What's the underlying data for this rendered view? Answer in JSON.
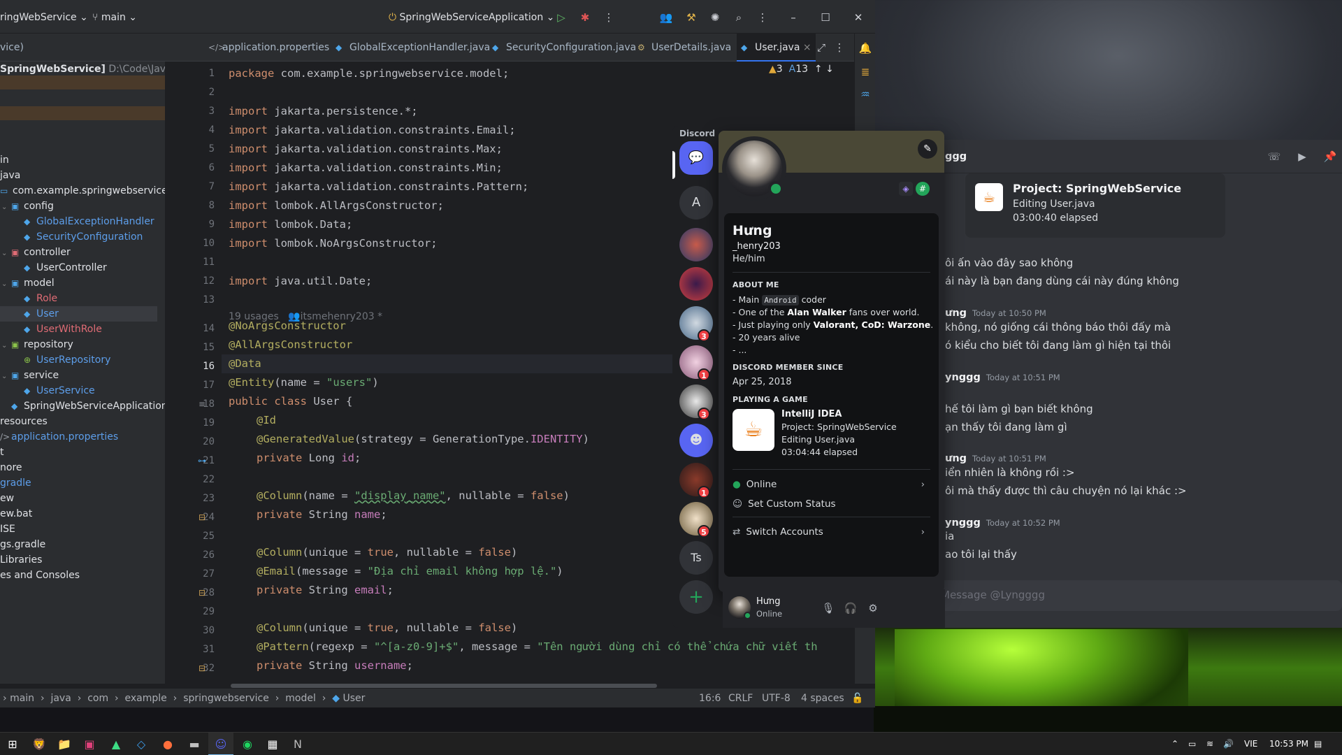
{
  "ide": {
    "project_name": "ringWebService",
    "branch": "main",
    "run_config": "SpringWebServiceApplication",
    "tabs": [
      {
        "label": "vice)",
        "icon": ""
      },
      {
        "label": "application.properties",
        "icon": "</>"
      },
      {
        "label": "GlobalExceptionHandler.java",
        "icon": "◆"
      },
      {
        "label": "SecurityConfiguration.java",
        "icon": "◆"
      },
      {
        "label": "UserDetails.java",
        "icon": "⚙"
      },
      {
        "label": "User.java",
        "icon": "◆",
        "close": "×"
      }
    ],
    "inspections": {
      "warnings": "3",
      "typos": "13"
    },
    "tree_root": "SpringWebService]",
    "tree_root_path": "D:\\Code\\Java\\S",
    "tree": [
      {
        "label": "in"
      },
      {
        "label": "java"
      },
      {
        "label": "com.example.springwebservice"
      },
      {
        "label": "config"
      },
      {
        "label": "GlobalExceptionHandler"
      },
      {
        "label": "SecurityConfiguration"
      },
      {
        "label": "controller"
      },
      {
        "label": "UserController"
      },
      {
        "label": "model"
      },
      {
        "label": "Role"
      },
      {
        "label": "User"
      },
      {
        "label": "UserWithRole"
      },
      {
        "label": "repository"
      },
      {
        "label": "UserRepository"
      },
      {
        "label": "service"
      },
      {
        "label": "UserService"
      },
      {
        "label": "SpringWebServiceApplication"
      },
      {
        "label": "resources"
      },
      {
        "label": "application.properties"
      },
      {
        "label": "t"
      },
      {
        "label": "nore"
      },
      {
        "label": "gradle"
      },
      {
        "label": "ew"
      },
      {
        "label": "ew.bat"
      },
      {
        "label": "ISE"
      },
      {
        "label": "gs.gradle"
      },
      {
        "label": "Libraries"
      },
      {
        "label": "es and Consoles"
      }
    ],
    "line_numbers": [
      "1",
      "2",
      "3",
      "4",
      "5",
      "6",
      "7",
      "8",
      "9",
      "10",
      "11",
      "12",
      "13",
      "14",
      "15",
      "16",
      "17",
      "18",
      "19",
      "20",
      "21",
      "22",
      "23",
      "24",
      "25",
      "26",
      "27",
      "28",
      "29",
      "30",
      "31",
      "32"
    ],
    "usage_hint": "19 usages",
    "usage_author": "itsmehenry203 *",
    "code": {
      "l1": [
        "package",
        " com.example.springwebservice.model;"
      ],
      "l3": [
        "import",
        " jakarta.persistence.*;"
      ],
      "l4": [
        "import",
        " jakarta.validation.constraints.Email;"
      ],
      "l5": [
        "import",
        " jakarta.validation.constraints.Max;"
      ],
      "l6": [
        "import",
        " jakarta.validation.constraints.Min;"
      ],
      "l7": [
        "import",
        " jakarta.validation.constraints.Pattern;"
      ],
      "l8": [
        "import",
        " lombok.AllArgsConstructor;"
      ],
      "l9": [
        "import",
        " lombok.Data;"
      ],
      "l10": [
        "import",
        " lombok.NoArgsConstructor;"
      ],
      "l12": [
        "import",
        " java.util.Date;"
      ],
      "l14": "@NoArgsConstructor",
      "l15": "@AllArgsConstructor",
      "l16": "@Data",
      "l17": [
        "@Entity",
        "(name = ",
        "\"users\"",
        ")"
      ],
      "l18": [
        "public class",
        " User {"
      ],
      "l19": "@Id",
      "l20": [
        "@GeneratedValue",
        "(strategy = GenerationType.",
        "IDENTITY",
        ")"
      ],
      "l21": [
        "private",
        " Long ",
        "id",
        ";"
      ],
      "l23": [
        "@Column",
        "(name = ",
        "\"display_name\"",
        ", nullable = ",
        "false",
        ")"
      ],
      "l24": [
        "private",
        " String ",
        "name",
        ";"
      ],
      "l26": [
        "@Column",
        "(unique = ",
        "true",
        ", nullable = ",
        "false",
        ")"
      ],
      "l27": [
        "@Email",
        "(message = ",
        "\"Địa chỉ email không hợp lệ.\"",
        ")"
      ],
      "l28": [
        "private",
        " String ",
        "email",
        ";"
      ],
      "l30": [
        "@Column",
        "(unique = ",
        "true",
        ", nullable = ",
        "false",
        ")"
      ],
      "l31": [
        "@Pattern",
        "(regexp = ",
        "\"^[a-z0-9]+$\"",
        ", message = ",
        "\"Tên người dùng chỉ có thể chứa chữ viết th"
      ],
      "l32": [
        "private",
        " String ",
        "username",
        ";"
      ]
    },
    "breadcrumbs": [
      "main",
      "java",
      "com",
      "example",
      "springwebservice",
      "model",
      "User"
    ],
    "status": {
      "position": "16:6",
      "line_sep": "CRLF",
      "encoding": "UTF-8",
      "indent": "4 spaces"
    }
  },
  "discord": {
    "brand": "Discord",
    "servers": [
      {
        "label": "",
        "badge": ""
      },
      {
        "label": "A",
        "badge": ""
      },
      {
        "label": "",
        "badge": ""
      },
      {
        "label": "",
        "badge": ""
      },
      {
        "label": "",
        "badge": "3"
      },
      {
        "label": "",
        "badge": "1"
      },
      {
        "label": "",
        "badge": "3"
      },
      {
        "label": "",
        "badge": ""
      },
      {
        "label": "",
        "badge": "1"
      },
      {
        "label": "",
        "badge": "5"
      },
      {
        "label": "Ts",
        "badge": ""
      },
      {
        "label": "+",
        "badge": ""
      }
    ],
    "profile": {
      "display_name": "Hưng",
      "username": "_henry203",
      "pronouns": "He/him",
      "about_heading": "ABOUT ME",
      "about_lines": [
        {
          "pre": "- Main ",
          "code": "Android",
          "post": " coder"
        },
        {
          "pre": "- One of the ",
          "bold": "Alan Walker",
          "post": " fans over world."
        },
        {
          "pre": "- Just playing only ",
          "bold": "Valorant, CoD: Warzone",
          "post": "."
        },
        {
          "pre": "- 20 years alive"
        },
        {
          "pre": "- ..."
        }
      ],
      "member_since_heading": "DISCORD MEMBER SINCE",
      "member_since": "Apr 25, 2018",
      "playing_heading": "PLAYING A GAME",
      "game_name": "IntelliJ IDEA",
      "game_details": "Project: SpringWebService",
      "game_state": "Editing User.java",
      "game_elapsed": "03:04:44 elapsed",
      "menu_online": "Online",
      "menu_custom_status": "Set Custom Status",
      "menu_switch": "Switch Accounts"
    },
    "user_panel": {
      "name": "Hưng",
      "status": "Online"
    },
    "dm": {
      "header_name": "ggg",
      "activity": {
        "title": "Project: SpringWebService",
        "state": "Editing User.java",
        "elapsed": "03:00:40 elapsed"
      },
      "messages": [
        {
          "author": "",
          "time": "",
          "lines": [
            "ôi ấn vào đây sao không",
            "ái này là bạn đang dùng cái này đúng không"
          ]
        },
        {
          "author": "ưng",
          "time": "Today at 10:50 PM",
          "lines": [
            "không, nó giống cái thông báo thôi đấy mà",
            "ó kiểu cho biết tôi đang làm gì hiện tại thôi"
          ]
        },
        {
          "author": "ynggg",
          "time": "Today at 10:51 PM",
          "lines": [
            "hế tôi làm gì bạn biết không",
            "ạn thấy tôi đang làm gì"
          ]
        },
        {
          "author": "ưng",
          "time": "Today at 10:51 PM",
          "lines": [
            "iển nhiên là không rồi :>",
            "ôi mà thấy được thì câu chuyện nó lại khác :>"
          ]
        },
        {
          "author": "ynggg",
          "time": "Today at 10:52 PM",
          "lines": [
            "ia",
            "ao tôi lại thấy"
          ]
        }
      ],
      "input_placeholder": "Message @Lyngggg"
    }
  },
  "taskbar": {
    "language": "VIE",
    "time": "10:53 PM"
  }
}
